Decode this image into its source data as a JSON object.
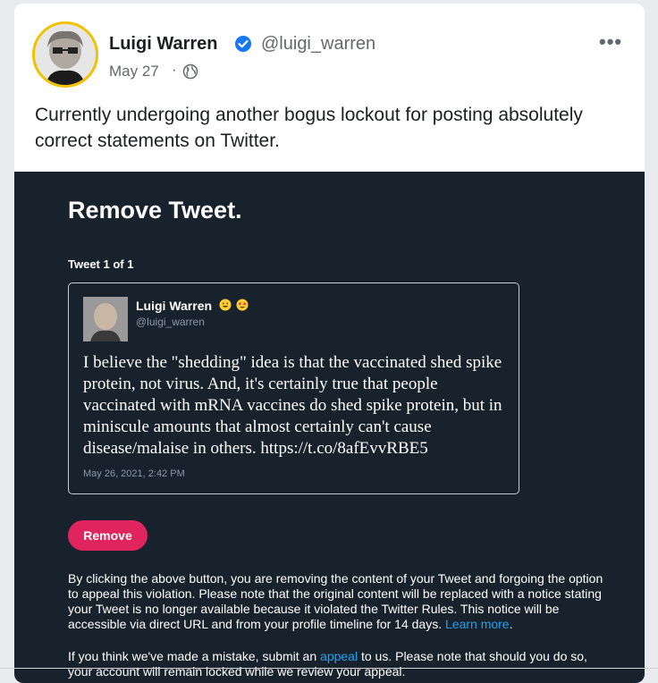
{
  "post": {
    "author_name": "Luigi Warren",
    "author_handle": "@luigi_warren",
    "date": "May 27",
    "separator": "·",
    "privacy_icon": "globe-icon",
    "more_icon": "more-options-icon",
    "more_label": "•••",
    "text": "Currently undergoing another bogus lockout for posting absolutely correct statements on Twitter."
  },
  "screenshot": {
    "title": "Remove Tweet.",
    "tweet_count": "Tweet 1 of 1",
    "embedded_tweet": {
      "author_name": "Luigi Warren",
      "author_handle": "@luigi_warren",
      "emojis": [
        "grinning-face-emoji",
        "star-struck-emoji"
      ],
      "text": "I believe the \"shedding\" idea is that the vaccinated shed spike protein, not virus. And, it's certainly true that people vaccinated with mRNA vaccines do shed spike protein, but in miniscule amounts that almost certainly can't cause disease/malaise in others. https://t.co/8afEvvRBE5",
      "timestamp": "May 26, 2021, 2:42 PM"
    },
    "remove_button": "Remove",
    "notice_text": "By clicking the above button, you are removing the content of your Tweet and forgoing the option to appeal this violation. Please note that the original content will be replaced with a notice stating your Tweet is no longer available because it violated the Twitter Rules. This notice will be accessible via direct URL and from your profile timeline for 14 days.",
    "learn_more": "Learn more",
    "learn_more_suffix": ".",
    "appeal_prefix": "If you think we've made a mistake, submit an",
    "appeal_link": "appeal",
    "appeal_suffix": "to us. Please note that should you do so, your account will remain locked while we review your appeal."
  },
  "colors": {
    "card_bg": "#ffffff",
    "dark_bg": "#18222d",
    "remove_button": "#e0245e",
    "link": "#1da1f2",
    "verified": "#1877f2",
    "avatar_ring": "#f2c200"
  }
}
